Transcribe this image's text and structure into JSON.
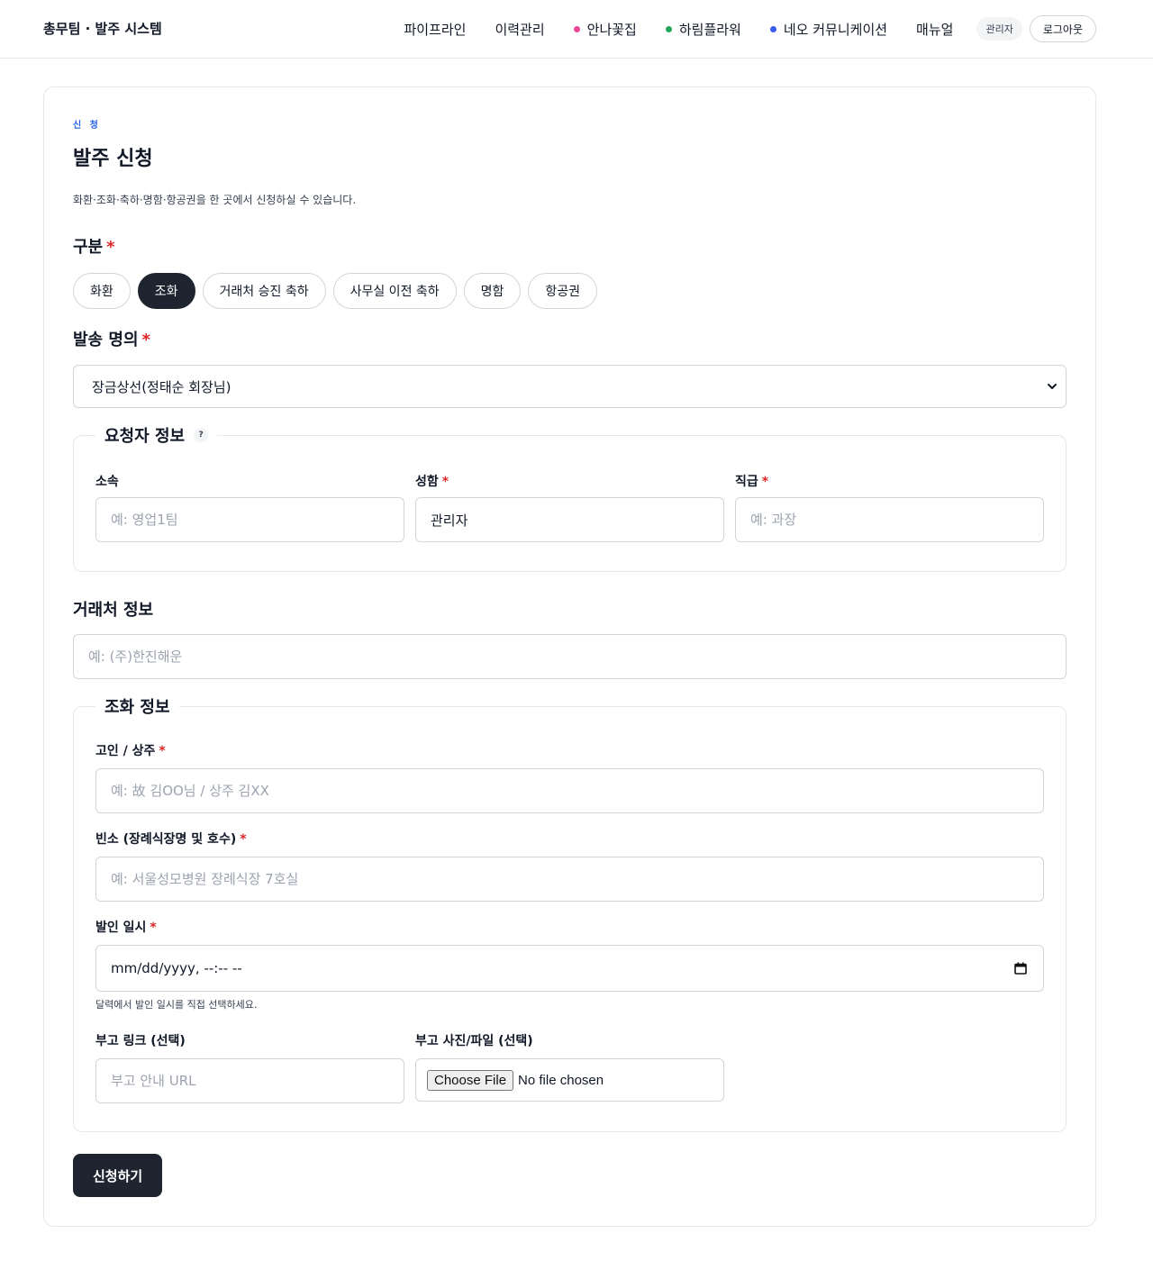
{
  "header": {
    "brand": "총무팀 · 발주 시스템",
    "nav": [
      {
        "label": "파이프라인",
        "dot": null
      },
      {
        "label": "이력관리",
        "dot": null
      },
      {
        "label": "안나꽃집",
        "dot": "#ec4899"
      },
      {
        "label": "하림플라워",
        "dot": "#22a55a"
      },
      {
        "label": "네오 커뮤니케이션",
        "dot": "#3b5bf0"
      },
      {
        "label": "매뉴얼",
        "dot": null
      }
    ],
    "role_badge": "관리자",
    "logout_label": "로그아웃"
  },
  "page": {
    "eyebrow": "신 청",
    "title": "발주 신청",
    "subtitle": "화환·조화·축하·명함·항공권을 한 곳에서 신청하실 수 있습니다."
  },
  "category": {
    "label": "구분",
    "required_mark": "*",
    "options": [
      "화환",
      "조화",
      "거래처 승진 축하",
      "사무실 이전 축하",
      "명함",
      "항공권"
    ],
    "selected": "조화"
  },
  "sender": {
    "label": "발송 명의",
    "required_mark": "*",
    "selected_value": "장금상선(정태순 회장님)"
  },
  "requester": {
    "legend": "요청자 정보",
    "help_icon": "?",
    "dept": {
      "label": "소속",
      "placeholder": "예: 영업1팀",
      "value": ""
    },
    "name": {
      "label": "성함",
      "required_mark": "*",
      "placeholder": "",
      "value": "관리자"
    },
    "rank": {
      "label": "직급",
      "required_mark": "*",
      "placeholder": "예: 과장",
      "value": ""
    }
  },
  "client": {
    "label": "거래처 정보",
    "placeholder": "예: (주)한진해운",
    "value": ""
  },
  "condolence": {
    "legend": "조화 정보",
    "deceased": {
      "label": "고인 / 상주",
      "required_mark": "*",
      "placeholder": "예: 故 김OO님 / 상주 김XX",
      "value": ""
    },
    "venue": {
      "label": "빈소 (장례식장명 및 호수)",
      "required_mark": "*",
      "placeholder": "예: 서울성모병원 장례식장 7호실",
      "value": ""
    },
    "funeral_date": {
      "label": "발인 일시",
      "required_mark": "*",
      "display": "mm/dd/yyyy, --:-- --",
      "hint": "달력에서 발인 일시를 직접 선택하세요."
    },
    "obituary_link": {
      "label": "부고 링크 (선택)",
      "placeholder": "부고 안내 URL",
      "value": ""
    },
    "obituary_file": {
      "label": "부고 사진/파일 (선택)",
      "button": "Choose File",
      "status": "No file chosen"
    }
  },
  "submit_label": "신청하기",
  "colors": {
    "accent": "#2563eb",
    "primary_dark": "#1f2530",
    "required": "#dc2626",
    "border": "#d1d5db"
  },
  "icons": {
    "select_chevron": "chevron-down-icon",
    "datetime": "calendar-icon",
    "help": "help-circle-icon"
  }
}
